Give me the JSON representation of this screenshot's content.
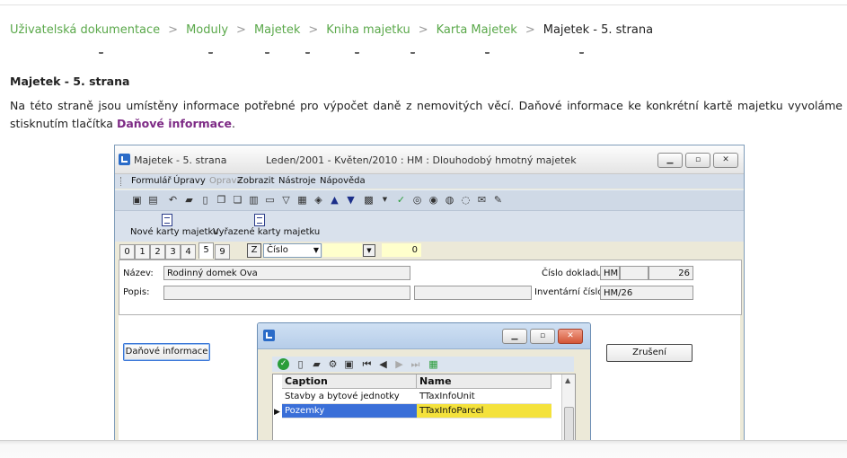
{
  "breadcrumb": {
    "items": [
      "Uživatelská dokumentace",
      "Moduly",
      "Majetek",
      "Kniha majetku",
      "Karta Majetek"
    ],
    "current": "Majetek - 5. strana"
  },
  "heading": "Majetek - 5. strana",
  "paragraph": {
    "text": "Na této straně jsou umístěny informace potřebné pro výpočet daně z nemovitých věcí. Daňové informace ke konkrétní kartě majetku vyvoláme stisknutím tlačítka ",
    "link_text": "Daňové informace",
    "end": "."
  },
  "window": {
    "title": "Majetek - 5. strana",
    "subtitle": "Leden/2001 - Květen/2010 : HM : Dlouhodobý hmotný majetek",
    "menu": [
      "Formulář",
      "Úpravy",
      "Oprava",
      "Zobrazit",
      "Nástroje",
      "Nápověda"
    ],
    "toolbar2": [
      "Nové karty majetku",
      "Vyřazené karty majetku"
    ],
    "tabs": [
      "0",
      "1",
      "2",
      "3",
      "4",
      "5",
      "9"
    ],
    "z_label": "Z",
    "combo_value": "Číslo",
    "num_value": "0",
    "form": {
      "nazev_label": "Název:",
      "nazev_value": "Rodinný domek Ova",
      "popis_label": "Popis:",
      "doc_label": "Číslo dokladu:",
      "doc_prefix": "HM",
      "doc_number": "26",
      "inv_label": "Inventární číslo:",
      "inv_value": "HM/26"
    },
    "dan_button": "Daňové informace",
    "zruseni_button": "Zrušení",
    "grid": {
      "headers": [
        "Caption",
        "Name"
      ],
      "rows": [
        {
          "caption": "Stavby a bytové jednotky",
          "name": "TTaxInfoUnit"
        },
        {
          "caption": "Pozemky",
          "name": "TTaxInfoParcel"
        }
      ]
    }
  }
}
